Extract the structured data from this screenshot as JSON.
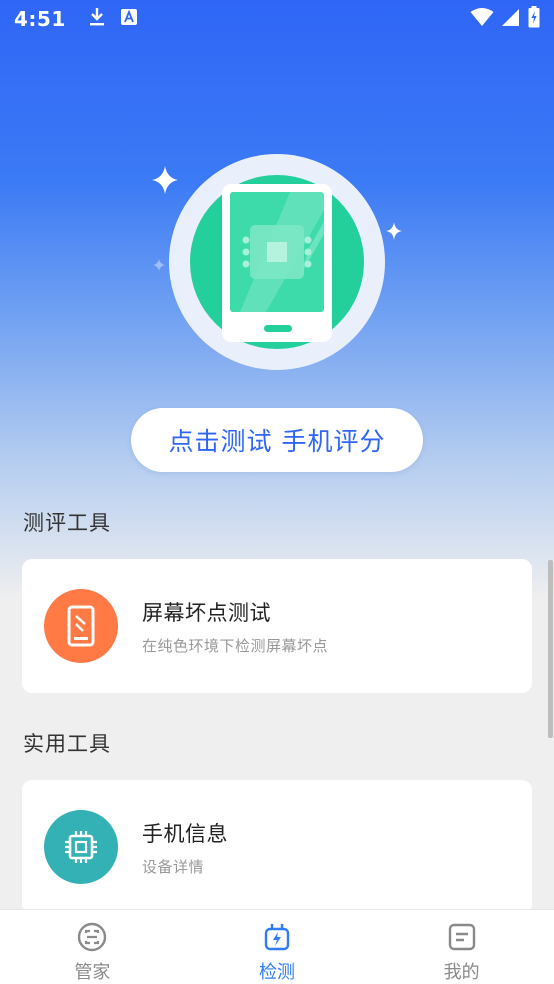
{
  "status_bar": {
    "time": "4:51",
    "icons": [
      "download-icon",
      "keyboard-a-icon",
      "wifi-icon",
      "signal-icon",
      "battery-charging-icon"
    ]
  },
  "hero": {
    "button_label": "点击测试 手机评分",
    "accent_color": "#2f66f6",
    "illustration": "phone-chip-icon"
  },
  "sections": [
    {
      "title": "测评工具",
      "cards": [
        {
          "title": "屏幕坏点测试",
          "description": "在纯色环境下检测屏幕坏点",
          "icon": "screen-test-icon",
          "icon_color": "#ff7a45"
        }
      ]
    },
    {
      "title": "实用工具",
      "cards": [
        {
          "title": "手机信息",
          "description": "设备详情",
          "icon": "chip-icon",
          "icon_color": "#34b1b4"
        }
      ]
    }
  ],
  "bottom_nav": {
    "items": [
      {
        "label": "管家",
        "icon": "butler-icon",
        "active": false
      },
      {
        "label": "检测",
        "icon": "detect-plug-icon",
        "active": true
      },
      {
        "label": "我的",
        "icon": "profile-doc-icon",
        "active": false
      }
    ],
    "active_color": "#2f7cf6"
  }
}
